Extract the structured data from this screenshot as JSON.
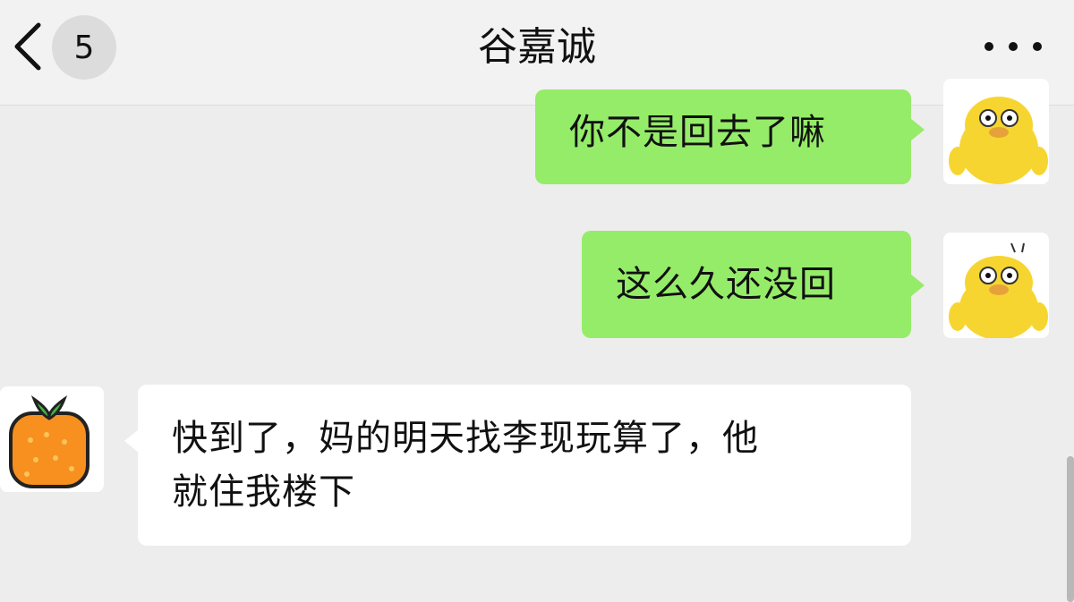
{
  "header": {
    "back_icon": "chevron-left-icon",
    "unread_count": "5",
    "title": "谷嘉诚",
    "more_icon": "more-horizontal-icon"
  },
  "messages": [
    {
      "direction": "outgoing",
      "text": "你不是回去了嘛",
      "avatar": "yellow-duck"
    },
    {
      "direction": "outgoing",
      "text": "这么久还没回",
      "avatar": "yellow-duck"
    },
    {
      "direction": "incoming",
      "text_line1": "快到了，妈的明天找李现玩算了，他",
      "text_line2": "就住我楼下",
      "avatar": "orange-fruit"
    }
  ],
  "colors": {
    "background": "#ededed",
    "outgoing_bubble": "#95ec69",
    "incoming_bubble": "#ffffff"
  }
}
